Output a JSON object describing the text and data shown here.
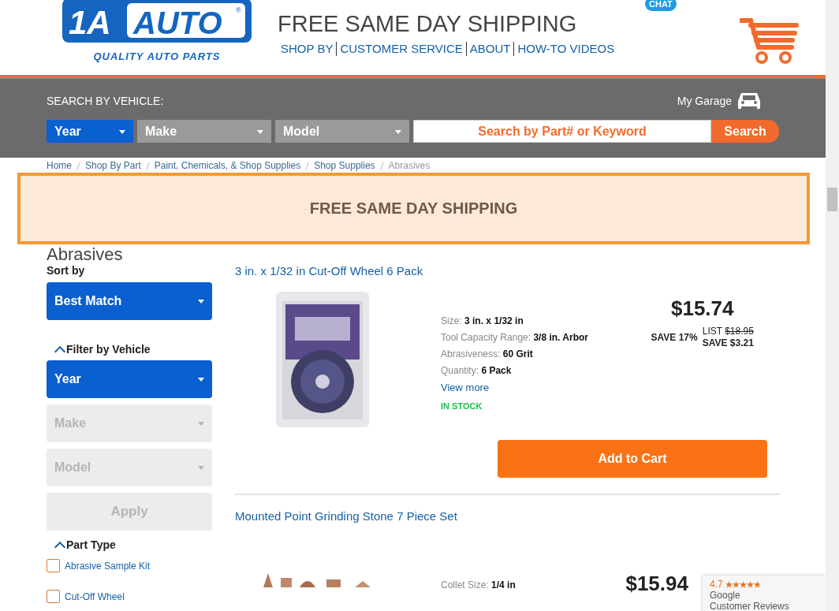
{
  "header": {
    "logo": {
      "mark": "1A",
      "word": "AUTO",
      "reg": "®",
      "tagline": "QUALITY AUTO PARTS"
    },
    "headline": "FREE SAME DAY SHIPPING",
    "nav": [
      "SHOP BY",
      "CUSTOMER SERVICE",
      "ABOUT",
      "HOW-TO VIDEOS"
    ],
    "chat": "CHAT"
  },
  "vehicle_search": {
    "title": "SEARCH BY VEHICLE:",
    "garage": "My Garage",
    "selects": [
      {
        "label": "Year",
        "selected": true
      },
      {
        "label": "Make",
        "selected": false
      },
      {
        "label": "Model",
        "selected": false
      }
    ],
    "search": {
      "placeholder": "Search by Part# or Keyword"
    },
    "button": "Search"
  },
  "breadcrumb": [
    {
      "label": "Home",
      "current": false
    },
    {
      "label": "Shop By Part",
      "current": false
    },
    {
      "label": "Paint, Chemicals, & Shop Supplies",
      "current": false
    },
    {
      "label": "Shop Supplies",
      "current": false
    },
    {
      "label": "Abrasives",
      "current": true
    }
  ],
  "banner": "FREE SAME DAY SHIPPING",
  "heading": "Abrasives",
  "sidebar": {
    "sort_label": "Sort by",
    "sort_value": "Best Match",
    "vehicle_heading": "Filter by Vehicle",
    "vehicle_selects": [
      {
        "label": "Year",
        "disabled": false
      },
      {
        "label": "Make",
        "disabled": true
      },
      {
        "label": "Model",
        "disabled": true
      }
    ],
    "apply": {
      "label": "Apply",
      "disabled": true
    },
    "part_type_heading": "Part Type",
    "part_types": [
      {
        "label": "Abrasive Sample Kit",
        "checked": false
      },
      {
        "label": "Cut-Off Wheel",
        "checked": false
      }
    ]
  },
  "products": [
    {
      "title": "3 in. x 1/32 in Cut-Off Wheel 6 Pack",
      "specs": [
        {
          "label": "Size:",
          "value": "3 in. x 1/32 in"
        },
        {
          "label": "Tool Capacity Range:",
          "value": "3/8 in. Arbor"
        },
        {
          "label": "Abrasiveness:",
          "value": "60 Grit"
        },
        {
          "label": "Quantity:",
          "value": "6 Pack"
        }
      ],
      "view_more": "View more",
      "stock": "IN STOCK",
      "price": "$15.74",
      "save_percent": "SAVE 17%",
      "list_label": "LIST",
      "list_price": "$18.95",
      "save_amount": "SAVE $3.21",
      "button": "Add to Cart"
    },
    {
      "title": "Mounted Point Grinding Stone 7 Piece Set",
      "specs": [
        {
          "label": "Collet Size:",
          "value": "1/4 in"
        }
      ],
      "price": "$15.94"
    }
  ],
  "reviews_badge": {
    "rating": "4.7",
    "stars": 5,
    "line_1": "Google",
    "line_2": "Customer Reviews"
  }
}
